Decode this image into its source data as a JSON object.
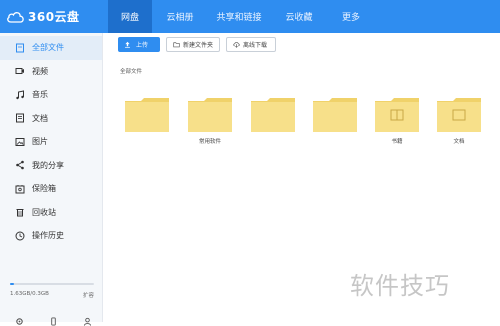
{
  "app": {
    "logo_text": "360云盘"
  },
  "nav": [
    {
      "label": "网盘",
      "active": true
    },
    {
      "label": "云相册"
    },
    {
      "label": "共享和链接"
    },
    {
      "label": "云收藏"
    },
    {
      "label": "更多"
    }
  ],
  "sidebar": {
    "items": [
      {
        "label": "全部文件",
        "icon": "file-icon",
        "active": true
      },
      {
        "label": "视频",
        "icon": "video-icon"
      },
      {
        "label": "音乐",
        "icon": "music-icon"
      },
      {
        "label": "文档",
        "icon": "document-icon"
      },
      {
        "label": "图片",
        "icon": "image-icon"
      },
      {
        "label": "我的分享",
        "icon": "share-icon"
      },
      {
        "label": "保险箱",
        "icon": "safe-icon"
      },
      {
        "label": "回收站",
        "icon": "trash-icon"
      },
      {
        "label": "操作历史",
        "icon": "history-icon"
      }
    ],
    "storage": {
      "used": "1.63GB/0.3GB",
      "action": "扩容",
      "fraction": 0.05
    }
  },
  "toolbar": {
    "upload_label": "上传",
    "new_folder_label": "新建文件夹",
    "offline_download_label": "离线下载"
  },
  "breadcrumb": "全部文件",
  "folders": [
    {
      "label": "",
      "marked": false
    },
    {
      "label": "常用软件",
      "marked": false
    },
    {
      "label": "",
      "marked": false
    },
    {
      "label": "",
      "marked": false
    },
    {
      "label": "书籍",
      "marked": true
    },
    {
      "label": "文档",
      "marked": true
    }
  ],
  "watermark": "软件技巧",
  "colors": {
    "accent": "#2f8df0",
    "folder": "#f7e08a",
    "folder_dark": "#f0d26a"
  }
}
